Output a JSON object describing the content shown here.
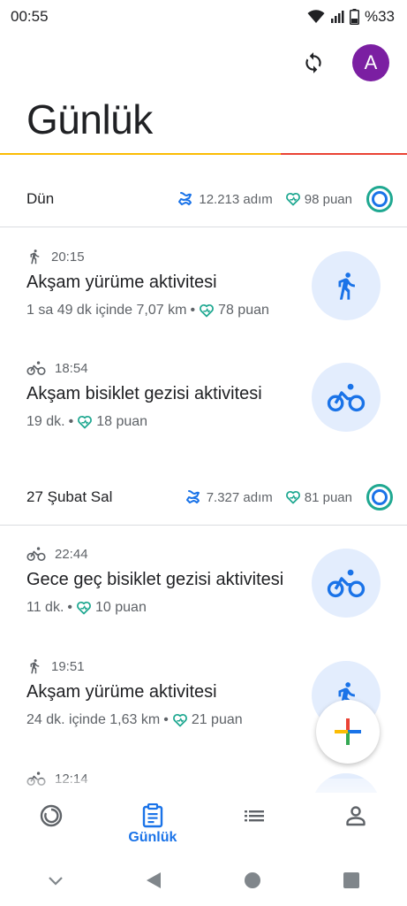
{
  "status_bar": {
    "time": "00:55",
    "battery": "%33",
    "icons": [
      "wifi-icon",
      "signal-icon",
      "battery-icon"
    ]
  },
  "header": {
    "title": "Günlük",
    "avatar_letter": "A",
    "avatar_color": "#7b1fa2",
    "sync_icon": "sync-icon"
  },
  "days": [
    {
      "label": "Dün",
      "steps": "12.213 adım",
      "points": "98 puan",
      "activities": [
        {
          "icon": "walk-icon",
          "time": "20:15",
          "title": "Akşam yürüme aktivitesi",
          "detail": "1 sa 49 dk içinde 7,07 km",
          "points": "78 puan"
        },
        {
          "icon": "bike-icon",
          "time": "18:54",
          "title": "Akşam bisiklet gezisi aktivitesi",
          "detail": "19 dk.",
          "points": "18 puan"
        }
      ]
    },
    {
      "label": "27 Şubat Sal",
      "steps": "7.327 adım",
      "points": "81 puan",
      "activities": [
        {
          "icon": "bike-icon",
          "time": "22:44",
          "title": "Gece geç bisiklet gezisi aktivitesi",
          "detail": "11 dk.",
          "points": "10 puan"
        },
        {
          "icon": "walk-icon",
          "time": "19:51",
          "title": "Akşam yürüme aktivitesi",
          "detail": "24 dk. içinde 1,63 km",
          "points": "21 puan"
        },
        {
          "icon": "bike-icon",
          "time": "12:14"
        }
      ]
    }
  ],
  "bottom_nav": {
    "items": [
      {
        "icon": "home-ring-icon",
        "label": ""
      },
      {
        "icon": "journal-icon",
        "label": "Günlük",
        "active": true
      },
      {
        "icon": "browse-list-icon",
        "label": ""
      },
      {
        "icon": "profile-icon",
        "label": ""
      }
    ]
  },
  "colors": {
    "accent": "#1a73e8",
    "heart_points": "#1fa891",
    "title_rule_yellow": "#fbbc04",
    "title_rule_red": "#ea4335"
  }
}
